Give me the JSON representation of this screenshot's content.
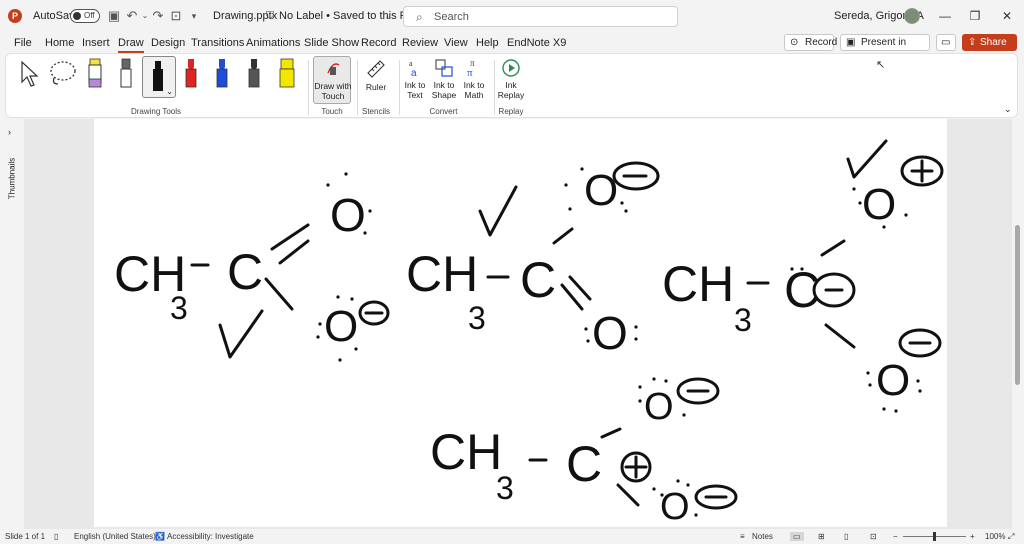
{
  "app": {
    "logo": "P",
    "autosave_label": "AutoSave",
    "autosave_state": "Off",
    "filename": "Drawing.pptx",
    "label_status": "No Label • Saved to this PC",
    "search_placeholder": "Search",
    "user_name": "Sereda, Grigoriy A"
  },
  "tabs": [
    "File",
    "Home",
    "Insert",
    "Draw",
    "Design",
    "Transitions",
    "Animations",
    "Slide Show",
    "Record",
    "Review",
    "View",
    "Help",
    "EndNote X9"
  ],
  "active_tab": "Draw",
  "right_buttons": {
    "record": "Record",
    "present": "Present in Teams",
    "share": "Share"
  },
  "ribbon": {
    "drawing_tools_label": "Drawing Tools",
    "draw_with_touch": "Draw with Touch",
    "touch_label": "Touch",
    "ruler": "Ruler",
    "stencils_label": "Stencils",
    "ink_to_text": "Ink to Text",
    "ink_to_shape": "Ink to Shape",
    "ink_to_math": "Ink to Math",
    "convert_label": "Convert",
    "ink_replay": "Ink Replay",
    "replay_label": "Replay",
    "pen_colors": [
      "#f5e23a",
      "#666666",
      "#111111",
      "#e02424",
      "#1e4ed8",
      "#333333",
      "#f5e600"
    ]
  },
  "left_panel": {
    "thumbnails_label": "Thumbnails"
  },
  "slide_ink": {
    "ch": "CH",
    "sub3": "3",
    "c": "C",
    "o": "O",
    "minus": "−",
    "plus": "+"
  },
  "status": {
    "slide": "Slide 1 of 1",
    "language": "English (United States)",
    "accessibility": "Accessibility: Investigate",
    "notes": "Notes",
    "zoom": "100%"
  },
  "icons": [
    "powerpoint-logo-icon",
    "save-icon",
    "undo-icon",
    "redo-icon",
    "present-icon",
    "search-icon",
    "pen-icon",
    "lasso-icon",
    "ruler-icon",
    "replay-icon"
  ]
}
